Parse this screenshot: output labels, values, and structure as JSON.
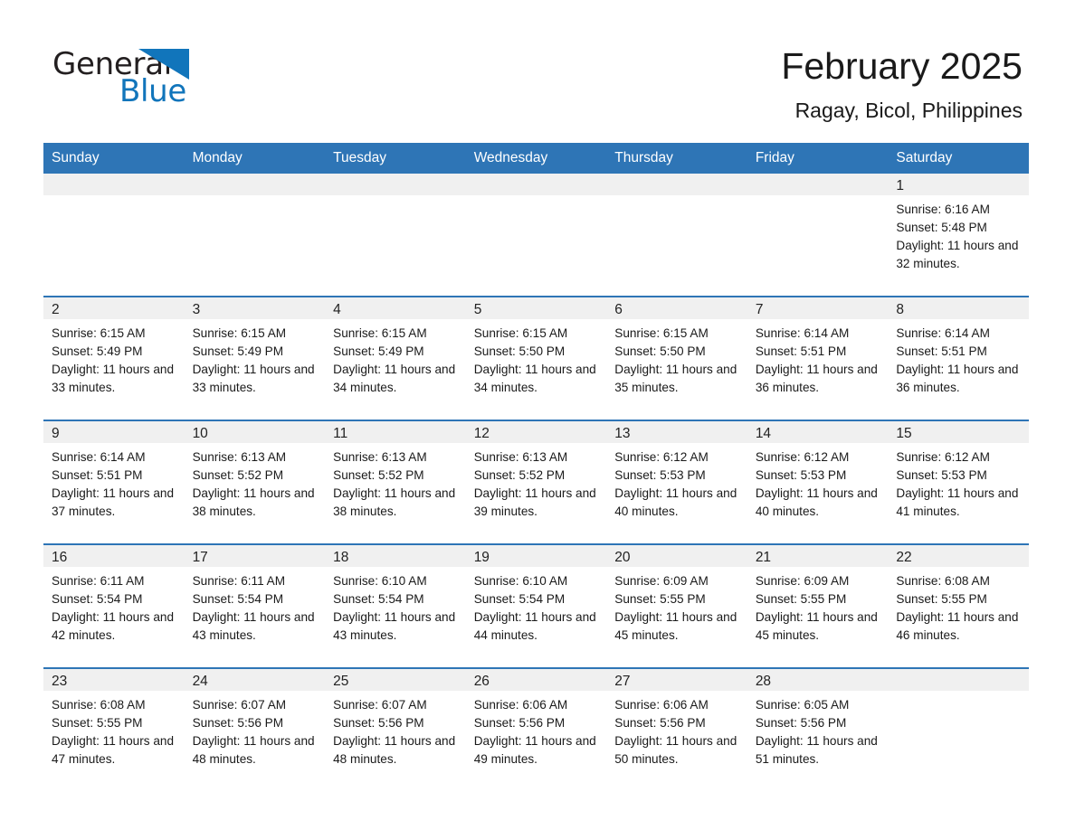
{
  "brand": {
    "name_part1": "General",
    "name_part2": "Blue",
    "accent_color": "#1175bb",
    "triangle_icon": "triangle-icon"
  },
  "header": {
    "title": "February 2025",
    "subtitle": "Ragay, Bicol, Philippines"
  },
  "theme": {
    "header_blue": "#2e75b6",
    "daynum_band": "#f0f0f0",
    "page_background": "#ffffff"
  },
  "calendar": {
    "weekday_headers": [
      "Sunday",
      "Monday",
      "Tuesday",
      "Wednesday",
      "Thursday",
      "Friday",
      "Saturday"
    ],
    "weeks": [
      [
        {
          "day": "",
          "blank": true
        },
        {
          "day": "",
          "blank": true
        },
        {
          "day": "",
          "blank": true
        },
        {
          "day": "",
          "blank": true
        },
        {
          "day": "",
          "blank": true
        },
        {
          "day": "",
          "blank": true
        },
        {
          "day": "1",
          "sunrise": "Sunrise: 6:16 AM",
          "sunset": "Sunset: 5:48 PM",
          "daylight": "Daylight: 11 hours and 32 minutes."
        }
      ],
      [
        {
          "day": "2",
          "sunrise": "Sunrise: 6:15 AM",
          "sunset": "Sunset: 5:49 PM",
          "daylight": "Daylight: 11 hours and 33 minutes."
        },
        {
          "day": "3",
          "sunrise": "Sunrise: 6:15 AM",
          "sunset": "Sunset: 5:49 PM",
          "daylight": "Daylight: 11 hours and 33 minutes."
        },
        {
          "day": "4",
          "sunrise": "Sunrise: 6:15 AM",
          "sunset": "Sunset: 5:49 PM",
          "daylight": "Daylight: 11 hours and 34 minutes."
        },
        {
          "day": "5",
          "sunrise": "Sunrise: 6:15 AM",
          "sunset": "Sunset: 5:50 PM",
          "daylight": "Daylight: 11 hours and 34 minutes."
        },
        {
          "day": "6",
          "sunrise": "Sunrise: 6:15 AM",
          "sunset": "Sunset: 5:50 PM",
          "daylight": "Daylight: 11 hours and 35 minutes."
        },
        {
          "day": "7",
          "sunrise": "Sunrise: 6:14 AM",
          "sunset": "Sunset: 5:51 PM",
          "daylight": "Daylight: 11 hours and 36 minutes."
        },
        {
          "day": "8",
          "sunrise": "Sunrise: 6:14 AM",
          "sunset": "Sunset: 5:51 PM",
          "daylight": "Daylight: 11 hours and 36 minutes."
        }
      ],
      [
        {
          "day": "9",
          "sunrise": "Sunrise: 6:14 AM",
          "sunset": "Sunset: 5:51 PM",
          "daylight": "Daylight: 11 hours and 37 minutes."
        },
        {
          "day": "10",
          "sunrise": "Sunrise: 6:13 AM",
          "sunset": "Sunset: 5:52 PM",
          "daylight": "Daylight: 11 hours and 38 minutes."
        },
        {
          "day": "11",
          "sunrise": "Sunrise: 6:13 AM",
          "sunset": "Sunset: 5:52 PM",
          "daylight": "Daylight: 11 hours and 38 minutes."
        },
        {
          "day": "12",
          "sunrise": "Sunrise: 6:13 AM",
          "sunset": "Sunset: 5:52 PM",
          "daylight": "Daylight: 11 hours and 39 minutes."
        },
        {
          "day": "13",
          "sunrise": "Sunrise: 6:12 AM",
          "sunset": "Sunset: 5:53 PM",
          "daylight": "Daylight: 11 hours and 40 minutes."
        },
        {
          "day": "14",
          "sunrise": "Sunrise: 6:12 AM",
          "sunset": "Sunset: 5:53 PM",
          "daylight": "Daylight: 11 hours and 40 minutes."
        },
        {
          "day": "15",
          "sunrise": "Sunrise: 6:12 AM",
          "sunset": "Sunset: 5:53 PM",
          "daylight": "Daylight: 11 hours and 41 minutes."
        }
      ],
      [
        {
          "day": "16",
          "sunrise": "Sunrise: 6:11 AM",
          "sunset": "Sunset: 5:54 PM",
          "daylight": "Daylight: 11 hours and 42 minutes."
        },
        {
          "day": "17",
          "sunrise": "Sunrise: 6:11 AM",
          "sunset": "Sunset: 5:54 PM",
          "daylight": "Daylight: 11 hours and 43 minutes."
        },
        {
          "day": "18",
          "sunrise": "Sunrise: 6:10 AM",
          "sunset": "Sunset: 5:54 PM",
          "daylight": "Daylight: 11 hours and 43 minutes."
        },
        {
          "day": "19",
          "sunrise": "Sunrise: 6:10 AM",
          "sunset": "Sunset: 5:54 PM",
          "daylight": "Daylight: 11 hours and 44 minutes."
        },
        {
          "day": "20",
          "sunrise": "Sunrise: 6:09 AM",
          "sunset": "Sunset: 5:55 PM",
          "daylight": "Daylight: 11 hours and 45 minutes."
        },
        {
          "day": "21",
          "sunrise": "Sunrise: 6:09 AM",
          "sunset": "Sunset: 5:55 PM",
          "daylight": "Daylight: 11 hours and 45 minutes."
        },
        {
          "day": "22",
          "sunrise": "Sunrise: 6:08 AM",
          "sunset": "Sunset: 5:55 PM",
          "daylight": "Daylight: 11 hours and 46 minutes."
        }
      ],
      [
        {
          "day": "23",
          "sunrise": "Sunrise: 6:08 AM",
          "sunset": "Sunset: 5:55 PM",
          "daylight": "Daylight: 11 hours and 47 minutes."
        },
        {
          "day": "24",
          "sunrise": "Sunrise: 6:07 AM",
          "sunset": "Sunset: 5:56 PM",
          "daylight": "Daylight: 11 hours and 48 minutes."
        },
        {
          "day": "25",
          "sunrise": "Sunrise: 6:07 AM",
          "sunset": "Sunset: 5:56 PM",
          "daylight": "Daylight: 11 hours and 48 minutes."
        },
        {
          "day": "26",
          "sunrise": "Sunrise: 6:06 AM",
          "sunset": "Sunset: 5:56 PM",
          "daylight": "Daylight: 11 hours and 49 minutes."
        },
        {
          "day": "27",
          "sunrise": "Sunrise: 6:06 AM",
          "sunset": "Sunset: 5:56 PM",
          "daylight": "Daylight: 11 hours and 50 minutes."
        },
        {
          "day": "28",
          "sunrise": "Sunrise: 6:05 AM",
          "sunset": "Sunset: 5:56 PM",
          "daylight": "Daylight: 11 hours and 51 minutes."
        },
        {
          "day": "",
          "blank": true
        }
      ]
    ]
  }
}
